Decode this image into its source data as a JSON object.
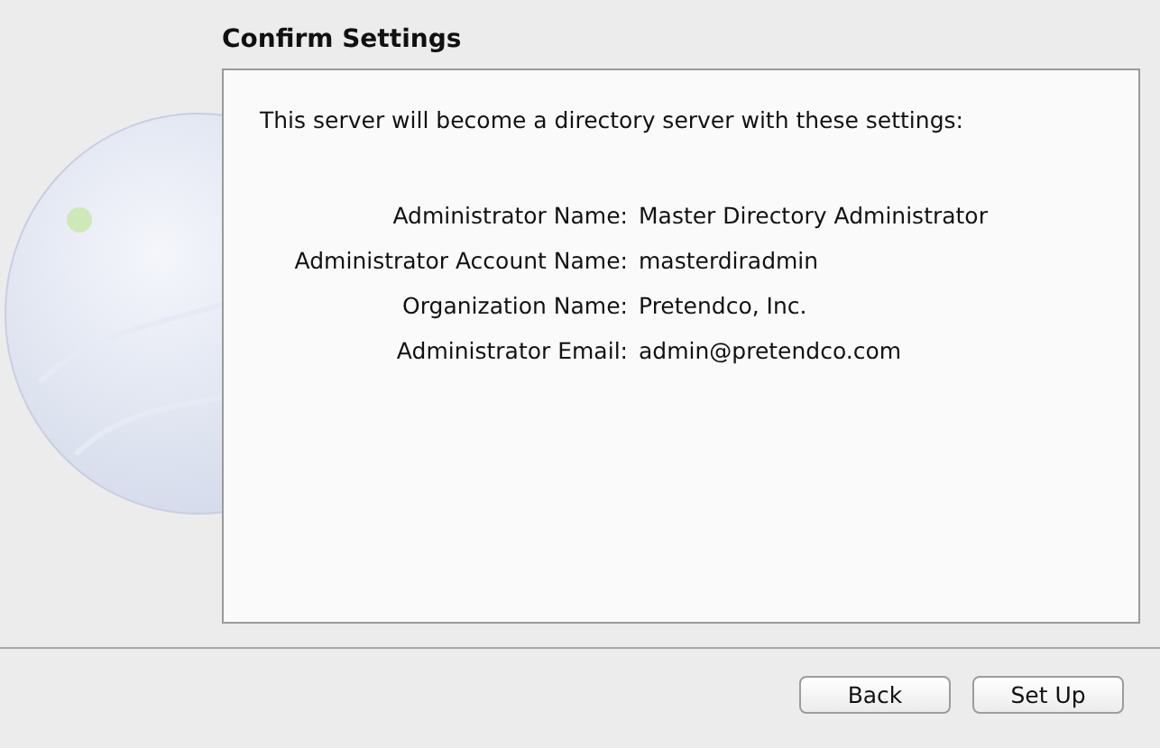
{
  "heading": "Confirm Settings",
  "intro": "This server will become a directory server with these settings:",
  "settings": [
    {
      "label": "Administrator Name:",
      "value": "Master Directory Administrator"
    },
    {
      "label": "Administrator Account Name:",
      "value": "masterdiradmin"
    },
    {
      "label": "Organization Name:",
      "value": "Pretendco, Inc."
    },
    {
      "label": "Administrator Email:",
      "value": "admin@pretendco.com"
    }
  ],
  "buttons": [
    "Back",
    "Set Up"
  ]
}
